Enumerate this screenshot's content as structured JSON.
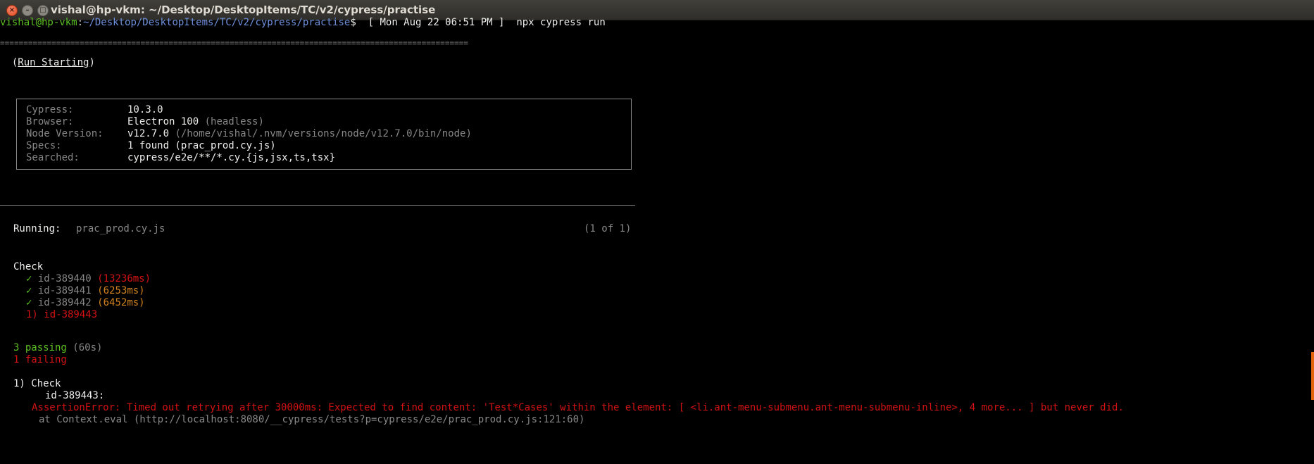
{
  "window": {
    "title": "vishal@hp-vkm: ~/Desktop/DesktopItems/TC/v2/cypress/practise",
    "close_glyph": "×",
    "min_glyph": "–",
    "max_glyph": "□"
  },
  "prompt": {
    "user_host": "vishal@hp-vkm",
    "colon": ":",
    "path": "~/Desktop/DesktopItems/TC/v2/cypress/practise",
    "dollar": "$  [ Mon Aug 22 06:51 PM ]  npx cypress run"
  },
  "separator_line": "====================================================================================================",
  "run_starting": {
    "open": "  (",
    "label": "Run Starting",
    "close": ")"
  },
  "info_box": {
    "rows": [
      {
        "key": "Cypress:",
        "value": "10.3.0",
        "extra": ""
      },
      {
        "key": "Browser:",
        "value": "Electron 100",
        "extra": " (headless)"
      },
      {
        "key": "Node Version:",
        "value": "v12.7.0",
        "extra": " (/home/vishal/.nvm/versions/node/v12.7.0/bin/node)"
      },
      {
        "key": "Specs:",
        "value": "1 found (prac_prod.cy.js)",
        "extra": ""
      },
      {
        "key": "Searched:",
        "value": "cypress/e2e/**/*.cy.{js,jsx,ts,tsx}",
        "extra": ""
      }
    ]
  },
  "running": {
    "label": "Running:",
    "spec": "prac_prod.cy.js",
    "count": "(1 of 1)"
  },
  "suite": {
    "name": "Check",
    "tests": [
      {
        "mark": "✓",
        "name": "id-389440",
        "time": "(13236ms)"
      },
      {
        "mark": "✓",
        "name": "id-389441",
        "time": "(6253ms)"
      },
      {
        "mark": "✓",
        "name": "id-389442",
        "time": "(6452ms)"
      }
    ],
    "failed_test": "1) id-389443"
  },
  "summary": {
    "passing": "3 passing",
    "duration": "(60s)",
    "failing": "1 failing"
  },
  "failure": {
    "heading": "1) Check",
    "test": "id-389443:",
    "error": "AssertionError: Timed out retrying after 30000ms: Expected to find content: 'Test*Cases' within the element: [ <li.ant-menu-submenu.ant-menu-submenu-inline>, 4 more... ] but never did.",
    "trace": "at Context.eval (http://localhost:8080/__cypress/tests?p=cypress/e2e/prac_prod.cy.js:121:60)"
  },
  "colors": {
    "background": "#000000",
    "prompt_user": "#5cbf22",
    "prompt_path": "#6d8fdc",
    "pass": "#5cbf22",
    "fail": "#d31212",
    "slow": "#d3831e",
    "dim": "#878787"
  }
}
